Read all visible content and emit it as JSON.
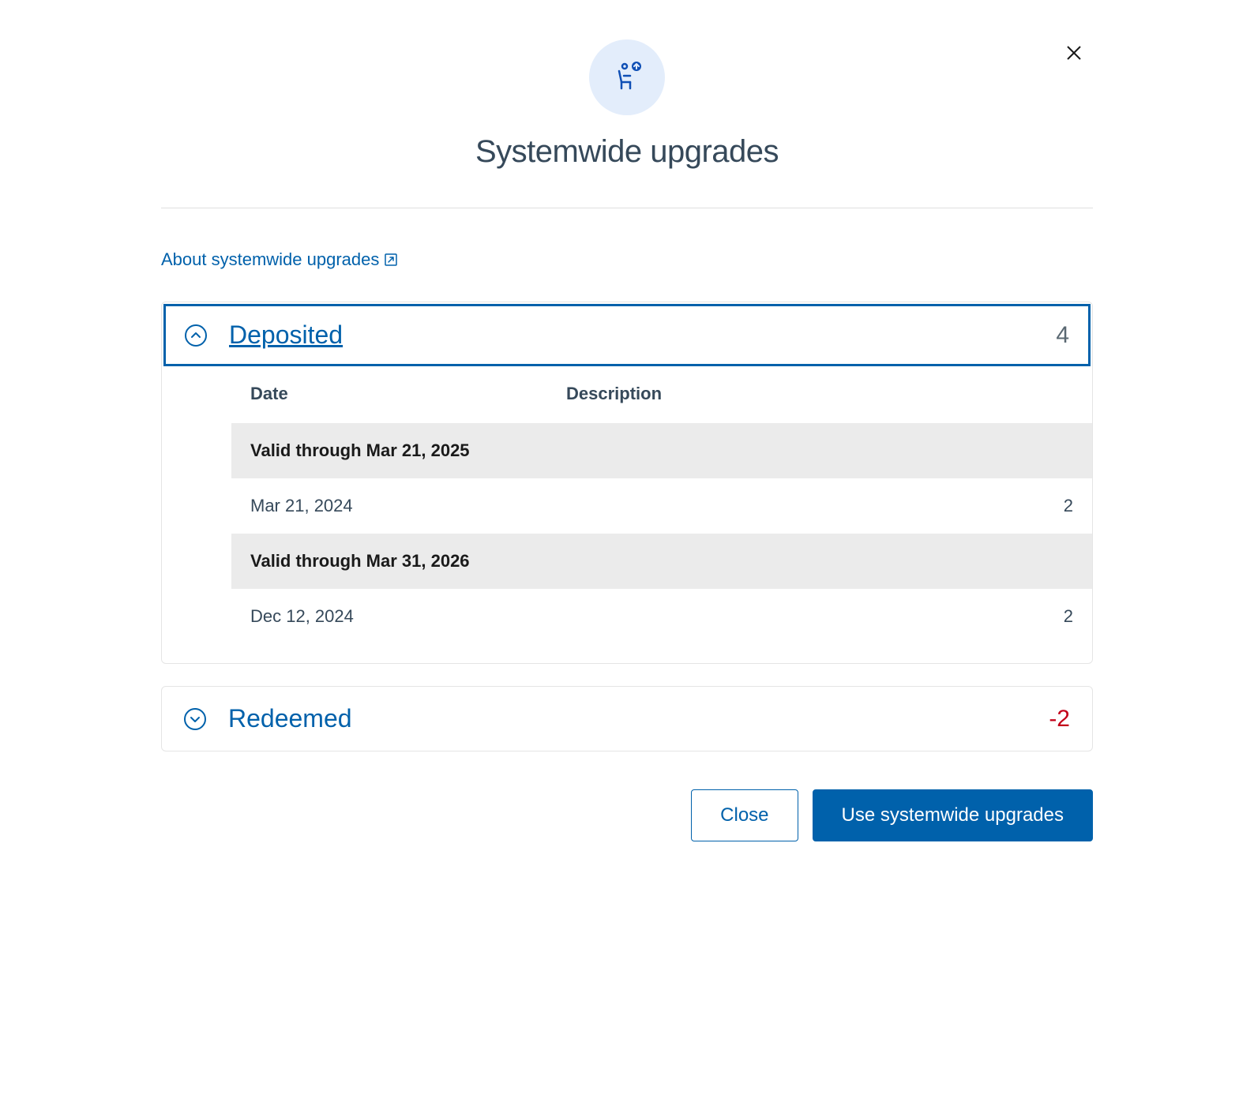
{
  "modal": {
    "title": "Systemwide upgrades",
    "about_link_text": "About systemwide upgrades",
    "close_button_label": "Close",
    "use_button_label": "Use systemwide upgrades"
  },
  "sections": {
    "deposited": {
      "title": "Deposited",
      "count": "4",
      "expanded": true,
      "columns": {
        "date": "Date",
        "description": "Description"
      },
      "groups": [
        {
          "valid_through": "Valid through Mar 21, 2025",
          "rows": [
            {
              "date": "Mar 21, 2024",
              "description": "",
              "count": "2"
            }
          ]
        },
        {
          "valid_through": "Valid through Mar 31, 2026",
          "rows": [
            {
              "date": "Dec 12, 2024",
              "description": "",
              "count": "2"
            }
          ]
        }
      ]
    },
    "redeemed": {
      "title": "Redeemed",
      "count": "-2",
      "expanded": false
    }
  }
}
